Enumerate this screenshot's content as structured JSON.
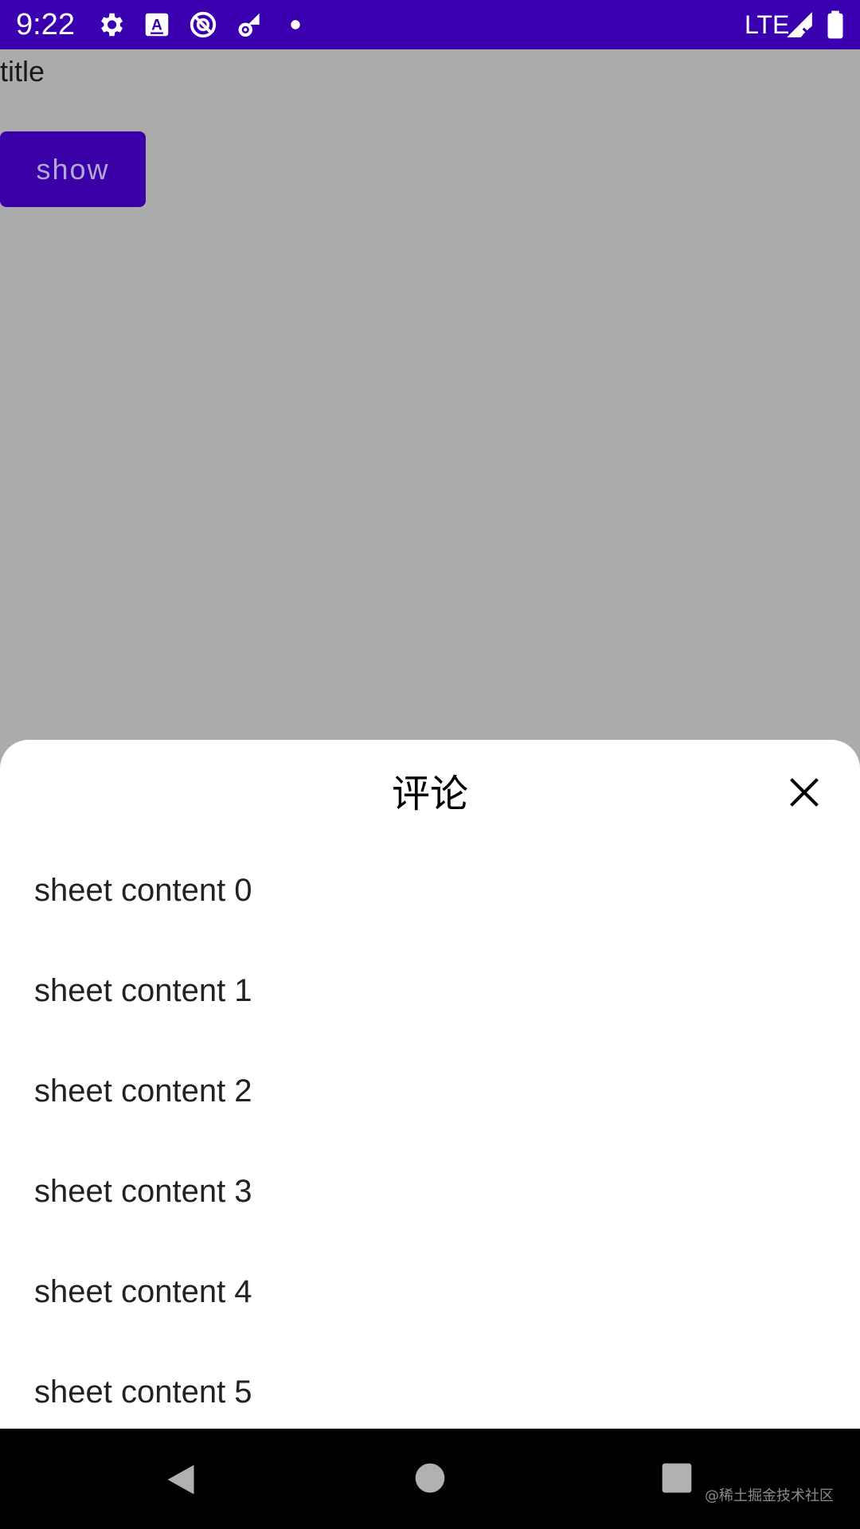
{
  "status_bar": {
    "time": "9:22",
    "network": "LTE",
    "icons": [
      "gear-icon",
      "keyboard-a-icon",
      "no-sync-icon",
      "settings-wifi-icon",
      "dot-icon",
      "signal-icon",
      "battery-icon"
    ]
  },
  "page": {
    "title": "title",
    "show_button_label": "show"
  },
  "sheet": {
    "title": "评论",
    "close_icon": "close-icon",
    "items": [
      "sheet content 0",
      "sheet content 1",
      "sheet content 2",
      "sheet content 3",
      "sheet content 4",
      "sheet content 5"
    ]
  },
  "nav_bar": {
    "watermark": "@稀土掘金技术社区"
  },
  "colors": {
    "status_bar": "#3a00b0",
    "button": "#3a00a8",
    "scrim": "#ababab",
    "sheet_bg": "#ffffff",
    "nav_bar": "#000000"
  }
}
